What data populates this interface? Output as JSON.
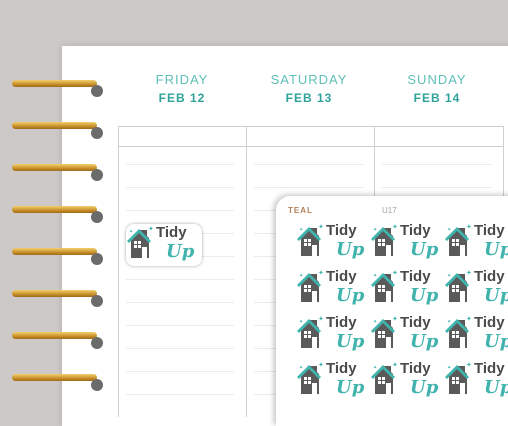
{
  "planner": {
    "days": [
      {
        "name": "FRIDAY",
        "date": "FEB 12"
      },
      {
        "name": "SATURDAY",
        "date": "FEB 13"
      },
      {
        "name": "SUNDAY",
        "date": "FEB 14"
      }
    ]
  },
  "sheet": {
    "color_label": "TEAL",
    "code": "U17"
  },
  "sticker": {
    "word1": "Tidy",
    "word2": "Up",
    "icon": "house-icon",
    "accent": "#3fb3ac",
    "house_color": "#5a5a5a"
  },
  "colors": {
    "background": "#cdc9c6",
    "day_name": "#5fbfb8",
    "day_date": "#2fa39a",
    "ring_gold": "#d9a441"
  }
}
